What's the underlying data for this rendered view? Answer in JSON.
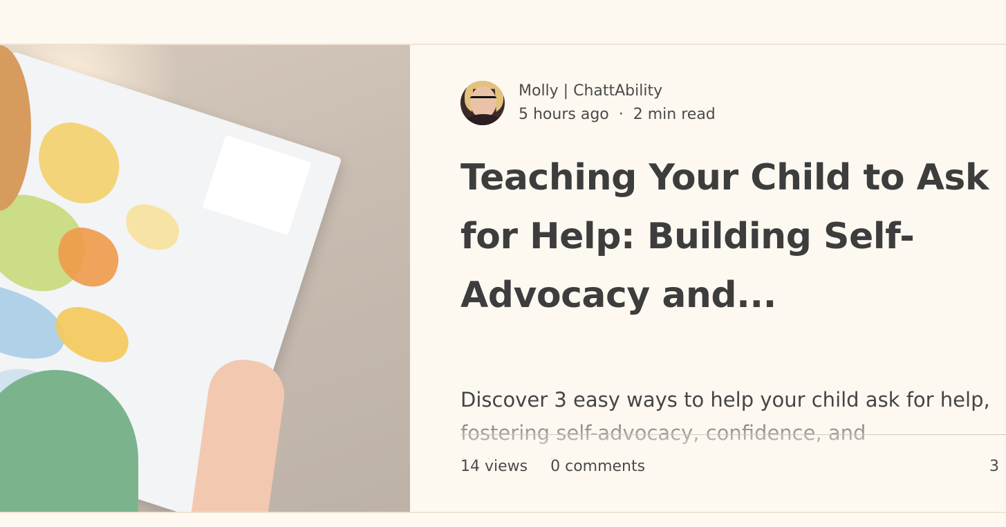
{
  "post": {
    "author_name": "Molly | ChattAbility",
    "published_ago": "5 hours ago",
    "separator": "·",
    "read_time": "2 min read",
    "title": "Teaching Your Child to Ask for Help: Building Self-Advocacy and...",
    "excerpt": "Discover 3 easy ways to help your child ask for help, fostering self-advocacy, confidence, and independence",
    "stats": {
      "views": "14 views",
      "comments": "0 comments",
      "likes": "3"
    },
    "image_icon": "photo-child-holding-map",
    "avatar_icon": "author-avatar"
  },
  "colors": {
    "background": "#fdf9f1",
    "border": "#f1e3d4",
    "title": "#3d3d3d",
    "text": "#4a4a4a",
    "divider": "#cfcac3"
  }
}
